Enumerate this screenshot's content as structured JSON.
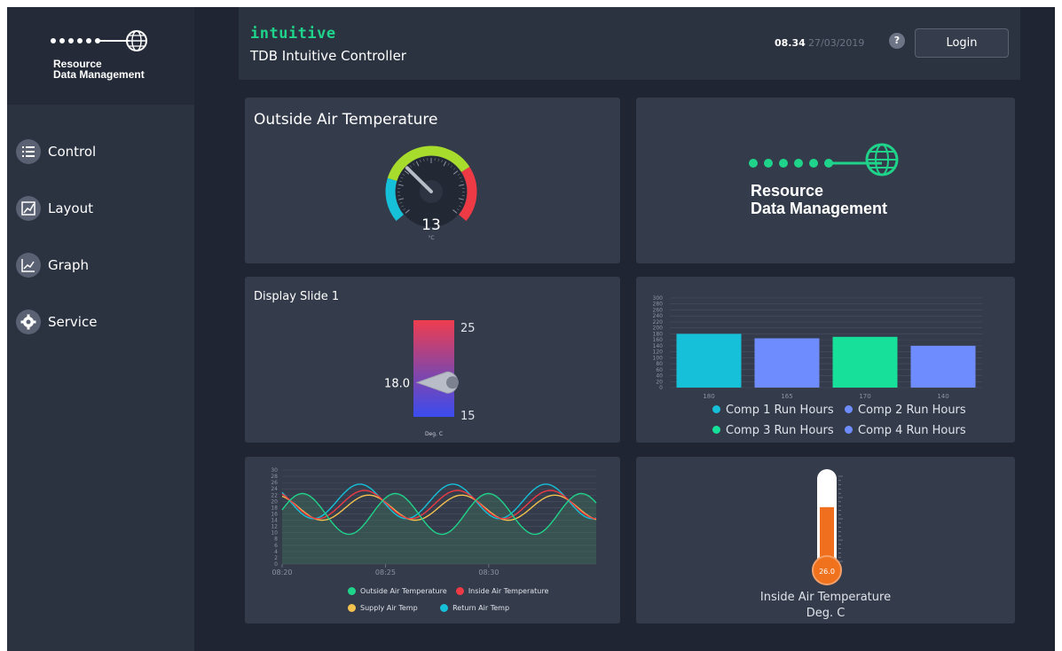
{
  "sidebar": {
    "brand_line1": "Resource",
    "brand_line2": "Data Management",
    "items": [
      {
        "label": "Control",
        "icon": "list-icon"
      },
      {
        "label": "Layout",
        "icon": "layout-icon"
      },
      {
        "label": "Graph",
        "icon": "graph-icon"
      },
      {
        "label": "Service",
        "icon": "gear-icon"
      }
    ]
  },
  "header": {
    "logo_word": "intuitive",
    "title": "TDB Intuitive Controller",
    "time": "08.34",
    "date": "27/03/2019",
    "help": "?",
    "login_label": "Login"
  },
  "gauge_panel": {
    "title": "Outside Air Temperature",
    "value": "13",
    "unit": "°C",
    "min": 0,
    "max": 40,
    "colors": {
      "low": "#16c0d8",
      "mid": "#a8dc2c",
      "high": "#ee3a44"
    }
  },
  "logo_panel": {
    "line1": "Resource",
    "line2": "Data Management",
    "color": "#1fd38a"
  },
  "slide_panel": {
    "title": "Display Slide 1",
    "max_label": "25",
    "min_label": "15",
    "value_label": "18.0",
    "unit": "Deg. C",
    "value": 18.0,
    "min": 15,
    "max": 25
  },
  "chart_data": [
    {
      "type": "bar",
      "categories": [
        "180",
        "165",
        "170",
        "140"
      ],
      "series": [
        {
          "name": "Comp 1 Run Hours",
          "values": [
            180,
            0,
            0,
            0
          ],
          "color": "#16c0d8"
        },
        {
          "name": "Comp 2 Run Hours",
          "values": [
            0,
            165,
            0,
            0
          ],
          "color": "#6f8cff"
        },
        {
          "name": "Comp 3 Run Hours",
          "values": [
            0,
            0,
            170,
            0
          ],
          "color": "#16e09a"
        },
        {
          "name": "Comp 4 Run Hours",
          "values": [
            0,
            0,
            0,
            140
          ],
          "color": "#6f8cff"
        }
      ],
      "values": [
        180,
        165,
        170,
        140
      ],
      "yticks": [
        "0",
        "20",
        "40",
        "60",
        "80",
        "100",
        "120",
        "140",
        "160",
        "180",
        "200",
        "220",
        "240",
        "260",
        "280",
        "300"
      ],
      "ylim": [
        0,
        300
      ],
      "grid": true,
      "legend": "bottom"
    },
    {
      "type": "line",
      "x_ticks": [
        "08:20",
        "08:25",
        "08:30"
      ],
      "yticks": [
        "0",
        "2",
        "4",
        "6",
        "8",
        "10",
        "12",
        "14",
        "16",
        "18",
        "20",
        "22",
        "24",
        "26",
        "28",
        "30"
      ],
      "ylim": [
        0,
        30
      ],
      "legend": "bottom",
      "series": [
        {
          "name": "Outside Air Temperature",
          "color": "#1fd38a",
          "period": 4.5,
          "center": 16,
          "amplitude": 6.5,
          "phase": 0.2
        },
        {
          "name": "Inside Air Temperature",
          "color": "#ee3a44",
          "period": 4.5,
          "center": 19,
          "amplitude": 4.5,
          "phase": 2.3
        },
        {
          "name": "Supply Air Temp",
          "color": "#f2c14e",
          "period": 4.5,
          "center": 18,
          "amplitude": 4.0,
          "phase": 2.0
        },
        {
          "name": "Return Air Temp",
          "color": "#16c0d8",
          "period": 4.5,
          "center": 20,
          "amplitude": 5.5,
          "phase": 2.6
        }
      ]
    }
  ],
  "thermo_panel": {
    "value": "26.0",
    "title": "Inside Air Temperature",
    "unit": "Deg. C",
    "level": 0.62
  }
}
